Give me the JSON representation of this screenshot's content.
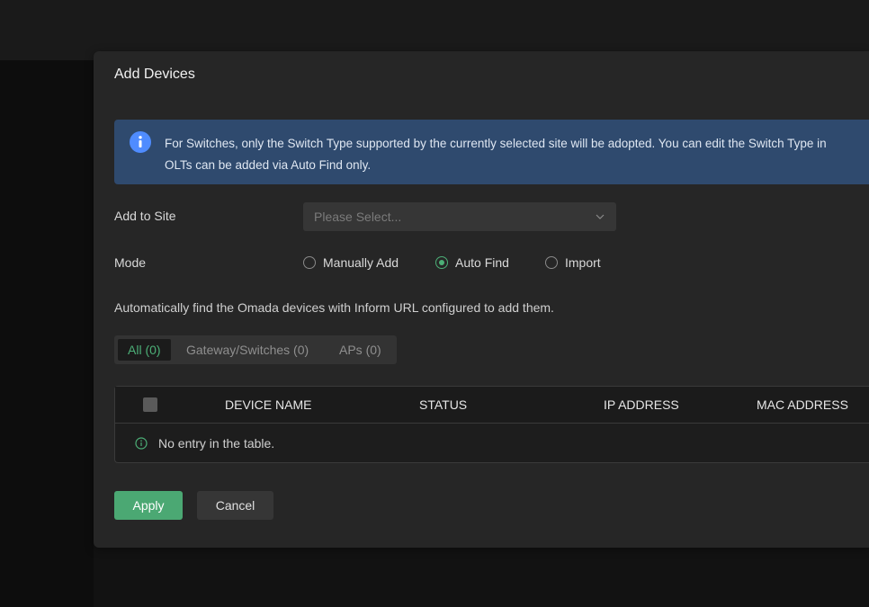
{
  "modal": {
    "title": "Add Devices"
  },
  "banner": {
    "line1": "For Switches, only the Switch Type supported by the currently selected site will be adopted. You can edit the Switch Type in",
    "line2": "OLTs can be added via Auto Find only.",
    "icon": "info-icon",
    "color": "#2f4a6e"
  },
  "site": {
    "label": "Add to Site",
    "placeholder": "Please Select..."
  },
  "mode": {
    "label": "Mode",
    "options": [
      {
        "label": "Manually Add",
        "selected": false
      },
      {
        "label": "Auto Find",
        "selected": true
      },
      {
        "label": "Import",
        "selected": false
      }
    ]
  },
  "description": "Automatically find the Omada devices with Inform URL configured to add them.",
  "tabs": [
    {
      "label": "All (0)",
      "active": true
    },
    {
      "label": "Gateway/Switches (0)",
      "active": false
    },
    {
      "label": "APs (0)",
      "active": false
    }
  ],
  "table": {
    "columns": [
      "DEVICE NAME",
      "STATUS",
      "IP ADDRESS",
      "MAC ADDRESS"
    ],
    "rows": [],
    "empty_text": "No entry in the table."
  },
  "buttons": {
    "apply": "Apply",
    "cancel": "Cancel"
  },
  "colors": {
    "accent": "#4ba873",
    "background": "#121212",
    "modal": "#262626"
  }
}
